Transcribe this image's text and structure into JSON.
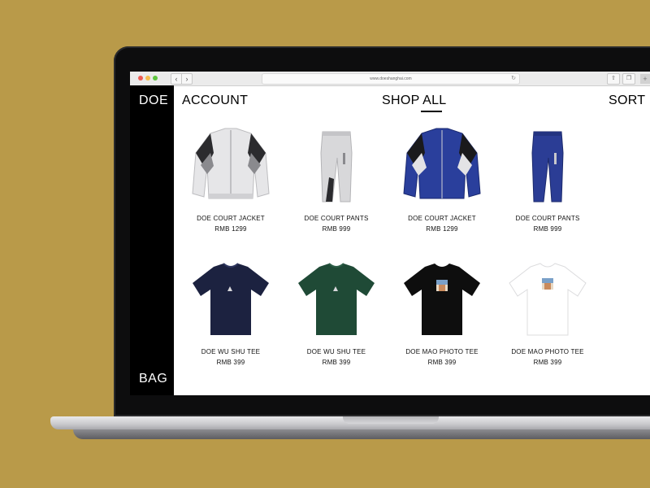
{
  "background_color": "#b99a49",
  "browser": {
    "url": "www.doeshanghai.com",
    "back_icon": "chevron-left-icon",
    "forward_icon": "chevron-right-icon",
    "reload_icon": "reload-icon",
    "share_icon": "share-icon",
    "tabs_icon": "tabs-icon",
    "new_tab_icon": "plus-icon"
  },
  "site": {
    "brand": "DOE",
    "bag": "BAG",
    "nav": {
      "account": "ACCOUNT",
      "shop_all": "SHOP ALL",
      "sort": "SORT"
    }
  },
  "products": [
    {
      "name": "DOE COURT JACKET",
      "price": "RMB 1299",
      "icon": "white-track-jacket-image",
      "color": "#e6e6e8"
    },
    {
      "name": "DOE COURT PANTS",
      "price": "RMB 999",
      "icon": "grey-track-pants-image",
      "color": "#d8d8da"
    },
    {
      "name": "DOE COURT JACKET",
      "price": "RMB 1299",
      "icon": "blue-track-jacket-image",
      "color": "#2a3f9c"
    },
    {
      "name": "DOE COURT PANTS",
      "price": "RMB 999",
      "icon": "blue-track-pants-image",
      "color": "#2b3d95"
    },
    {
      "name": "DOE WU SHU TEE",
      "price": "RMB 399",
      "icon": "navy-tee-image",
      "color": "#1c2240"
    },
    {
      "name": "DOE WU SHU TEE",
      "price": "RMB 399",
      "icon": "green-tee-image",
      "color": "#1f4a36"
    },
    {
      "name": "DOE MAO PHOTO TEE",
      "price": "RMB 399",
      "icon": "black-photo-tee-image",
      "color": "#0e0e0e"
    },
    {
      "name": "DOE MAO PHOTO TEE",
      "price": "RMB 399",
      "icon": "white-photo-tee-image",
      "color": "#ffffff"
    }
  ]
}
